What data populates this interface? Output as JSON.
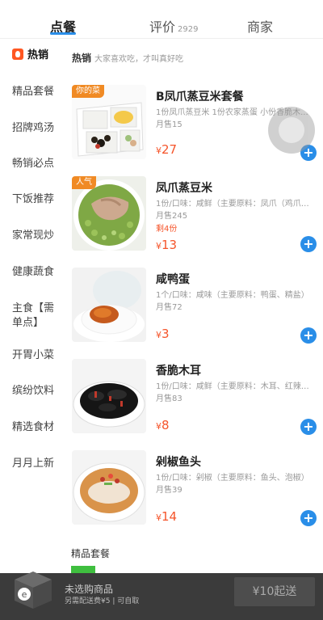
{
  "tabs": {
    "order": "点餐",
    "review": "评价",
    "review_count": "2929",
    "merchant": "商家"
  },
  "sidebar": {
    "items": [
      {
        "label": "热销"
      },
      {
        "label": "精品套餐"
      },
      {
        "label": "招牌鸡汤"
      },
      {
        "label": "畅销必点"
      },
      {
        "label": "下饭推荐"
      },
      {
        "label": "家常现炒"
      },
      {
        "label": "健康蔬食"
      },
      {
        "label": "主食【需单点】"
      },
      {
        "label": "开胃小菜"
      },
      {
        "label": "缤纷饮料"
      },
      {
        "label": "精选食材"
      },
      {
        "label": "月月上新"
      }
    ]
  },
  "section": {
    "title": "热销",
    "subtitle": "大家喜欢吃，才叫真好吃",
    "next_title": "精品套餐"
  },
  "items": [
    {
      "name": "B凤爪蒸豆米套餐",
      "tag": "你的菜",
      "desc": "1份凤爪蒸豆米  1份农家蒸蛋  小份香脆木...",
      "sales": "月售15",
      "remain": "",
      "yen": "¥",
      "price": "27",
      "color": "#f08a24"
    },
    {
      "name": "凤爪蒸豆米",
      "tag": "人气",
      "desc": "1份/口味：咸鲜（主要原料：凤爪（鸡爪或...",
      "sales": "月售245",
      "remain": "剩4份",
      "yen": "¥",
      "price": "13",
      "color": "#f08a24"
    },
    {
      "name": "咸鸭蛋",
      "tag": "",
      "desc": "1个/口味：咸味（主要原料：鸭蛋、精盐）",
      "sales": "月售72",
      "remain": "",
      "yen": "¥",
      "price": "3",
      "color": ""
    },
    {
      "name": "香脆木耳",
      "tag": "",
      "desc": "1份/口味：咸鲜（主要原料：木耳、红辣椒...",
      "sales": "月售83",
      "remain": "",
      "yen": "¥",
      "price": "8",
      "color": ""
    },
    {
      "name": "剁椒鱼头",
      "tag": "",
      "desc": "1份/口味：剁椒（主要原料：鱼头、泡椒）",
      "sales": "月售39",
      "remain": "",
      "yen": "¥",
      "price": "14",
      "color": ""
    }
  ],
  "cart": {
    "empty_text": "未选购商品",
    "delivery_text": "另需配送费¥5 | 可自取",
    "checkout_label": "¥10起送"
  },
  "colors": {
    "accent": "#2a8ee8",
    "price": "#f5542a",
    "tag": "#f08a24"
  }
}
